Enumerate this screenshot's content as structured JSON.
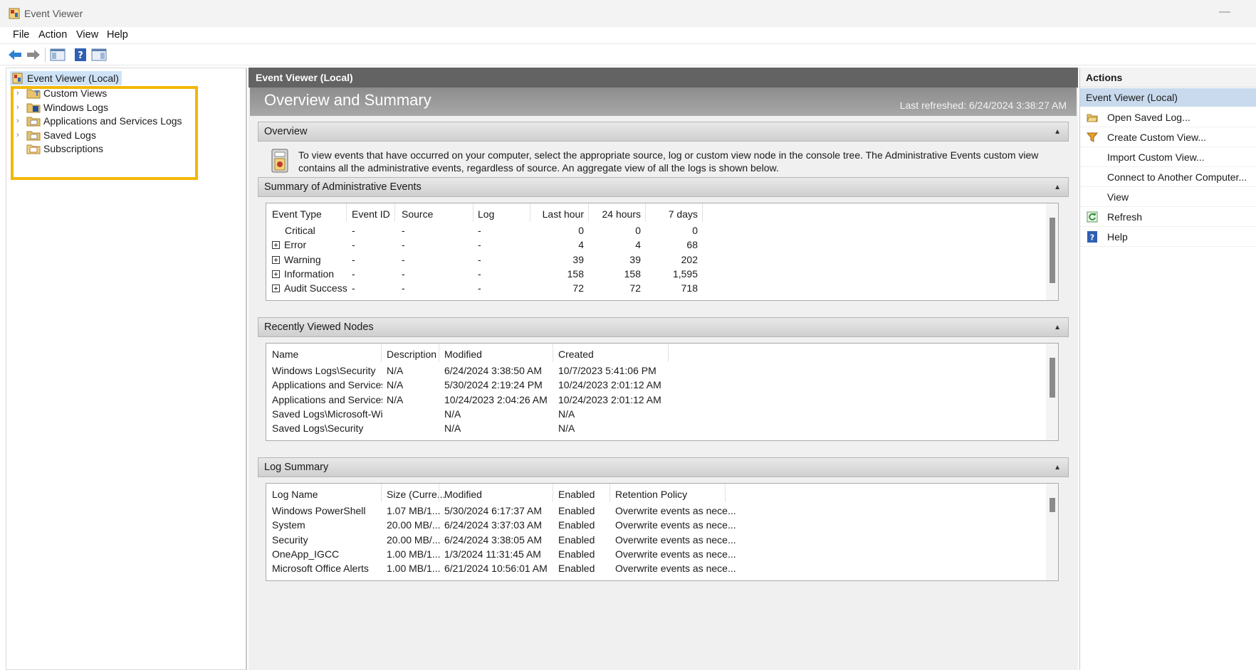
{
  "window": {
    "title": "Event Viewer",
    "minimize_glyph": "—"
  },
  "menu": [
    "File",
    "Action",
    "View",
    "Help"
  ],
  "toolbar": {
    "icons": [
      "back-arrow-icon",
      "forward-arrow-icon",
      "show-hide-console-tree-icon",
      "help-icon",
      "show-hide-action-pane-icon"
    ]
  },
  "tree": {
    "root": "Event Viewer (Local)",
    "items": [
      {
        "label": "Custom Views",
        "icon": "custom-views-folder-icon"
      },
      {
        "label": "Windows Logs",
        "icon": "windows-logs-folder-icon"
      },
      {
        "label": "Applications and Services Logs",
        "icon": "folder-icon"
      },
      {
        "label": "Saved Logs",
        "icon": "folder-icon"
      },
      {
        "label": "Subscriptions",
        "icon": "subscriptions-icon"
      }
    ]
  },
  "center": {
    "header": "Event Viewer (Local)",
    "title": "Overview and Summary",
    "last_refreshed": "Last refreshed: 6/24/2024 3:38:27 AM",
    "overview": {
      "title": "Overview",
      "text": "To view events that have occurred on your computer, select the appropriate source, log or custom view node in the console tree. The Administrative Events custom view contains all the administrative events, regardless of source. An aggregate view of all the logs is shown below."
    },
    "admin_summary": {
      "title": "Summary of Administrative Events",
      "columns": [
        "Event Type",
        "Event ID",
        "Source",
        "Log",
        "Last hour",
        "24 hours",
        "7 days"
      ],
      "rows": [
        {
          "type": "Critical",
          "expand": false,
          "id": "-",
          "source": "-",
          "log": "-",
          "hour": "0",
          "day": "0",
          "week": "0"
        },
        {
          "type": "Error",
          "expand": true,
          "id": "-",
          "source": "-",
          "log": "-",
          "hour": "4",
          "day": "4",
          "week": "68"
        },
        {
          "type": "Warning",
          "expand": true,
          "id": "-",
          "source": "-",
          "log": "-",
          "hour": "39",
          "day": "39",
          "week": "202"
        },
        {
          "type": "Information",
          "expand": true,
          "id": "-",
          "source": "-",
          "log": "-",
          "hour": "158",
          "day": "158",
          "week": "1,595"
        },
        {
          "type": "Audit Success",
          "expand": true,
          "id": "-",
          "source": "-",
          "log": "-",
          "hour": "72",
          "day": "72",
          "week": "718"
        }
      ]
    },
    "recent_nodes": {
      "title": "Recently Viewed Nodes",
      "columns": [
        "Name",
        "Description",
        "Modified",
        "Created"
      ],
      "rows": [
        {
          "name": "Windows Logs\\Security",
          "desc": "N/A",
          "modified": "6/24/2024 3:38:50 AM",
          "created": "10/7/2023 5:41:06 PM"
        },
        {
          "name": "Applications and Services ...",
          "desc": "N/A",
          "modified": "5/30/2024 2:19:24 PM",
          "created": "10/24/2023 2:01:12 AM"
        },
        {
          "name": "Applications and Services ...",
          "desc": "N/A",
          "modified": "10/24/2023 2:04:26 AM",
          "created": "10/24/2023 2:01:12 AM"
        },
        {
          "name": "Saved Logs\\Microsoft-Wi...",
          "desc": "",
          "modified": "N/A",
          "created": "N/A"
        },
        {
          "name": "Saved Logs\\Security",
          "desc": "",
          "modified": "N/A",
          "created": "N/A"
        }
      ]
    },
    "log_summary": {
      "title": "Log Summary",
      "columns": [
        "Log Name",
        "Size (Curre...",
        "Modified",
        "Enabled",
        "Retention Policy"
      ],
      "rows": [
        {
          "name": "Windows PowerShell",
          "size": "1.07 MB/1...",
          "modified": "5/30/2024 6:17:37 AM",
          "enabled": "Enabled",
          "policy": "Overwrite events as nece..."
        },
        {
          "name": "System",
          "size": "20.00 MB/...",
          "modified": "6/24/2024 3:37:03 AM",
          "enabled": "Enabled",
          "policy": "Overwrite events as nece..."
        },
        {
          "name": "Security",
          "size": "20.00 MB/...",
          "modified": "6/24/2024 3:38:05 AM",
          "enabled": "Enabled",
          "policy": "Overwrite events as nece..."
        },
        {
          "name": "OneApp_IGCC",
          "size": "1.00 MB/1...",
          "modified": "1/3/2024 11:31:45 AM",
          "enabled": "Enabled",
          "policy": "Overwrite events as nece..."
        },
        {
          "name": "Microsoft Office Alerts",
          "size": "1.00 MB/1...",
          "modified": "6/21/2024 10:56:01 AM",
          "enabled": "Enabled",
          "policy": "Overwrite events as nece..."
        }
      ]
    }
  },
  "actions": {
    "title": "Actions",
    "subheader": "Event Viewer (Local)",
    "items": [
      {
        "label": "Open Saved Log...",
        "icon": "open-folder-icon"
      },
      {
        "label": "Create Custom View...",
        "icon": "filter-funnel-icon"
      },
      {
        "label": "Import Custom View...",
        "icon": ""
      },
      {
        "label": "Connect to Another Computer...",
        "icon": ""
      },
      {
        "label": "View",
        "icon": ""
      },
      {
        "label": "Refresh",
        "icon": "refresh-icon"
      },
      {
        "label": "Help",
        "icon": "help-icon"
      }
    ]
  },
  "colors": {
    "accent_highlight": "#f2b705",
    "selection": "#c9daee",
    "header_dark": "#636363"
  }
}
